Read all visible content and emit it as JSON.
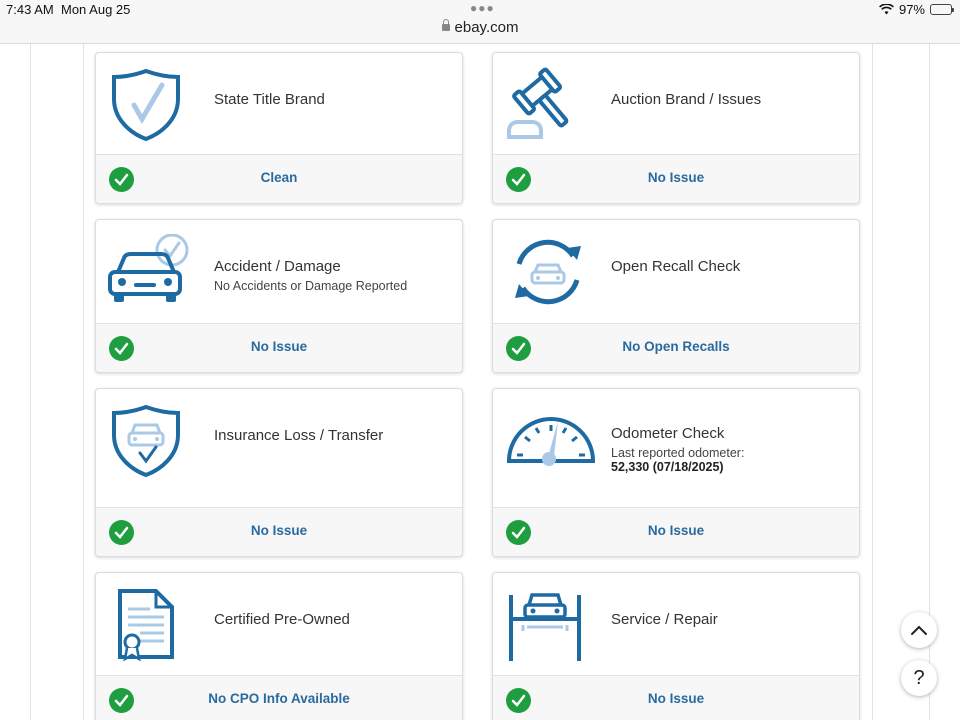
{
  "status_bar": {
    "time": "7:43 AM",
    "date": "Mon Aug 25",
    "battery": "97%",
    "battery_level": 0.97,
    "url": "ebay.com"
  },
  "colors": {
    "icon_blue": "#1e6aa3",
    "icon_light_blue": "#a9c9e6",
    "check_green": "#1e9e3f",
    "status_blue": "#2a6a9e"
  },
  "cards": [
    {
      "title": "State Title Brand",
      "sub": "",
      "sub2": "",
      "status": "Clean",
      "icon": "shield-check-icon"
    },
    {
      "title": "Auction Brand / Issues",
      "sub": "",
      "sub2": "",
      "status": "No Issue",
      "icon": "gavel-icon"
    },
    {
      "title": "Accident / Damage",
      "sub": "No Accidents or Damage Reported",
      "sub2": "",
      "status": "No Issue",
      "icon": "car-damage-icon"
    },
    {
      "title": "Open Recall Check",
      "sub": "",
      "sub2": "",
      "status": "No Open Recalls",
      "icon": "recall-cycle-icon"
    },
    {
      "title": "Insurance Loss / Transfer",
      "sub": "",
      "sub2": "",
      "status": "No Issue",
      "icon": "insurance-shield-car-icon"
    },
    {
      "title": "Odometer Check",
      "sub": "Last reported odometer:",
      "sub2": "52,330 (07/18/2025)",
      "status": "No Issue",
      "icon": "odometer-icon"
    },
    {
      "title": "Certified Pre-Owned",
      "sub": "",
      "sub2": "",
      "status": "No CPO Info Available",
      "icon": "certificate-icon"
    },
    {
      "title": "Service / Repair",
      "sub": "",
      "sub2": "",
      "status": "No Issue",
      "icon": "car-lift-icon"
    }
  ],
  "floating": {
    "scroll_top_icon": "chevron-up-icon",
    "help_label": "?"
  }
}
